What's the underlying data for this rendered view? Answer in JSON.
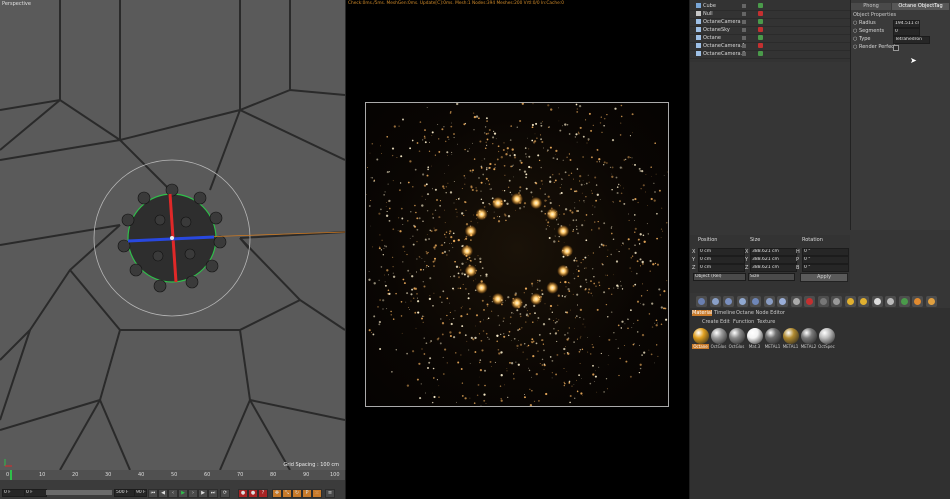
{
  "viewport": {
    "label": "Perspective",
    "grid_spacing": "Grid Spacing : 100 cm",
    "timeline_ticks": [
      "0",
      "10",
      "20",
      "30",
      "40",
      "50",
      "60",
      "70",
      "80",
      "90",
      "100"
    ],
    "frame_start": "0 F",
    "frame_current": "0 F",
    "frame_end": "500 F",
    "frame_right": "90 F"
  },
  "render": {
    "status": "Check:0ms./5ms. MeshGen:0ms. Update[C]:0ms. Mesh:1 Nodes:394 Meshes:200 Vrtl:0/0 In:Cache:0"
  },
  "objects": {
    "items": [
      {
        "name": "Cube",
        "color": "#7aa7d8"
      },
      {
        "name": "Null",
        "color": "#c7c7c7"
      },
      {
        "name": "OctaneCamera",
        "color": "#9ec0e6"
      },
      {
        "name": "OctaneSky",
        "color": "#9ec0e6"
      },
      {
        "name": "Octane",
        "color": "#9ec0e6"
      },
      {
        "name": "OctaneCamera.1",
        "color": "#9ec0e6"
      },
      {
        "name": "OctaneCamera.2",
        "color": "#9ec0e6"
      }
    ]
  },
  "attributes": {
    "tabs": [
      "Phong",
      "Octane ObjectTag"
    ],
    "section": "Object Properties",
    "fields": [
      {
        "label": "Radius",
        "value": "194.511 cm"
      },
      {
        "label": "Segments",
        "value": "0"
      },
      {
        "label": "Type",
        "value": "Tetrahedron"
      },
      {
        "label": "Render Perfect",
        "value": ""
      }
    ]
  },
  "coordinates": {
    "headers": [
      "Position",
      "Size",
      "Rotation"
    ],
    "rows": [
      {
        "axis": "X",
        "pos": "0 cm",
        "size": "388.621 cm",
        "rot_axis": "H",
        "rot": "0 °"
      },
      {
        "axis": "Y",
        "pos": "0 cm",
        "size": "388.621 cm",
        "rot_axis": "P",
        "rot": "0 °"
      },
      {
        "axis": "Z",
        "pos": "0 cm",
        "size": "388.621 cm",
        "rot_axis": "B",
        "rot": "0 °"
      }
    ],
    "mode": "Object (Rel)",
    "size_mode": "Size",
    "apply": "Apply"
  },
  "material_tabs": [
    "Material",
    "Timeline",
    "Octane Node Editor"
  ],
  "material_menu": [
    "Create",
    "Edit",
    "Function",
    "Texture"
  ],
  "materials": [
    {
      "name": "Octane",
      "color": "#e0a020"
    },
    {
      "name": "OctGlos",
      "color": "#9a9a9a"
    },
    {
      "name": "OctGlos",
      "color": "#8a8a8a"
    },
    {
      "name": "Mat.3",
      "color": "#f2f2f2"
    },
    {
      "name": "METAL1",
      "color": "#6e6e6e"
    },
    {
      "name": "METAL1",
      "color": "#b08a30"
    },
    {
      "name": "METAL2",
      "color": "#7a7a7a"
    },
    {
      "name": "OctSpec",
      "color": "#bdbdbd"
    }
  ]
}
